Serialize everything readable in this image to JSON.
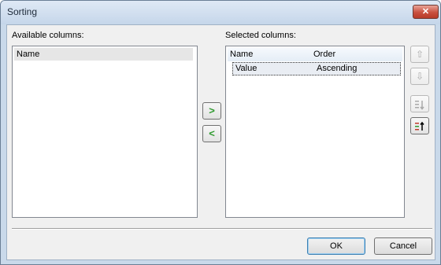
{
  "window": {
    "title": "Sorting",
    "close_glyph": "✕"
  },
  "available": {
    "label": "Available columns:",
    "items": [
      {
        "name": "Name"
      }
    ]
  },
  "selected": {
    "label": "Selected columns:",
    "columns": {
      "name": "Name",
      "order": "Order"
    },
    "rows": [
      {
        "name": "Value",
        "order": "Ascending"
      }
    ]
  },
  "transfer": {
    "add_glyph": ">",
    "remove_glyph": "<"
  },
  "reorder": {
    "up_glyph": "⇧",
    "down_glyph": "⇩"
  },
  "buttons": {
    "ok": "OK",
    "cancel": "Cancel"
  },
  "colors": {
    "accent_green": "#2f9a2f",
    "sort_red": "#c0392b",
    "disabled": "#a9a9a9"
  }
}
